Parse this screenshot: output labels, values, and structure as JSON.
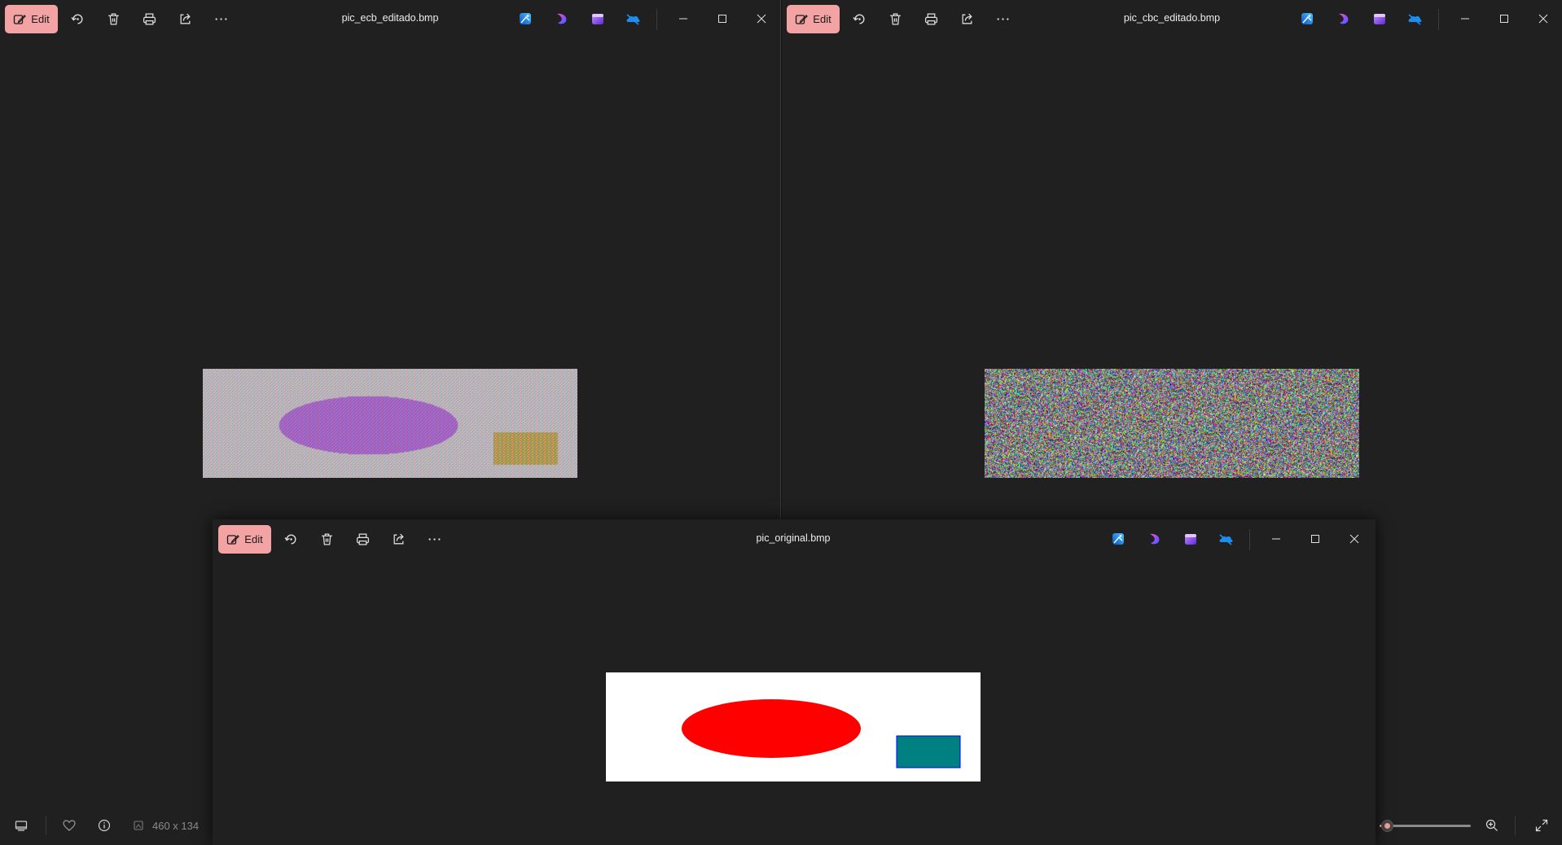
{
  "windows": [
    {
      "id": "ecb",
      "title": "pic_ecb_editado.bmp",
      "edit_label": "Edit",
      "image": "pic_ecb_editado",
      "icons": [
        "rotate-icon",
        "delete-icon",
        "print-icon",
        "share-icon",
        "more-icon"
      ],
      "app_icons": [
        "photos-app-icon",
        "designer-app-icon",
        "clipchamp-app-icon",
        "onedrive-app-icon"
      ]
    },
    {
      "id": "cbc",
      "title": "pic_cbc_editado.bmp",
      "edit_label": "Edit",
      "image": "pic_cbc_editado",
      "icons": [
        "rotate-icon",
        "delete-icon",
        "print-icon",
        "share-icon",
        "more-icon"
      ],
      "app_icons": [
        "photos-app-icon",
        "designer-app-icon",
        "clipchamp-app-icon",
        "onedrive-app-icon"
      ]
    },
    {
      "id": "orig",
      "title": "pic_original.bmp",
      "edit_label": "Edit",
      "image": "pic_original",
      "icons": [
        "rotate-icon",
        "delete-icon",
        "print-icon",
        "share-icon",
        "more-icon"
      ],
      "app_icons": [
        "photos-app-icon",
        "designer-app-icon",
        "clipchamp-app-icon",
        "onedrive-app-icon"
      ]
    }
  ],
  "statusbar": {
    "dimensions": "460 x 134",
    "icons": [
      "filmstrip-icon",
      "favorite-icon",
      "info-icon",
      "dimensions-icon",
      "zoom-in-icon",
      "fullscreen-icon"
    ],
    "zoom_fraction": 0.08
  },
  "colors": {
    "edit_accent": "#f3a3a3",
    "background": "#202020",
    "ellipse_red": "#ff0000",
    "rect_teal": "#008080",
    "rect_border": "#0000ff"
  }
}
